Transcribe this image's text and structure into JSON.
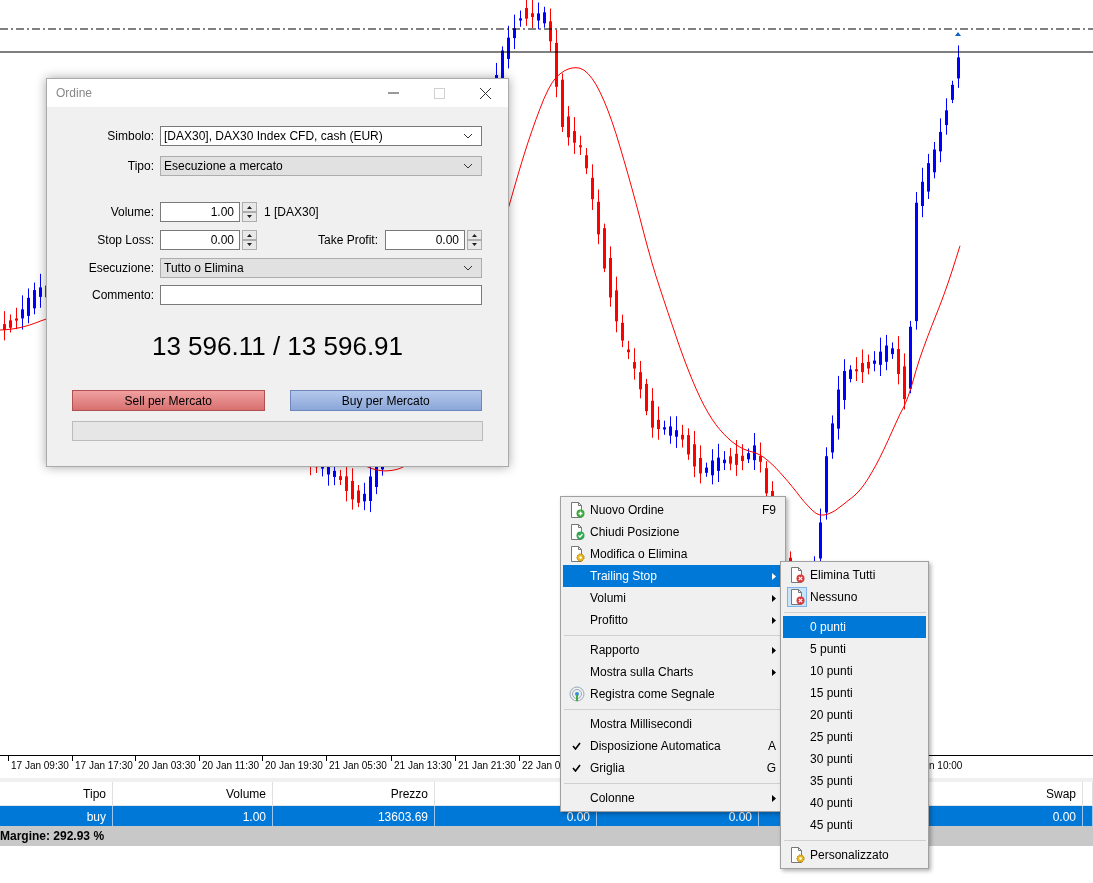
{
  "chart": {
    "time_labels": [
      "17 Jan 09:30",
      "17 Jan 17:30",
      "20 Jan 03:30",
      "20 Jan 11:30",
      "20 Jan 19:30",
      "21 Jan 05:30",
      "21 Jan 13:30",
      "21 Jan 21:30",
      "22 Jan 0",
      "n 10:00"
    ]
  },
  "positions_table": {
    "columns": [
      "Tipo",
      "Volume",
      "Prezzo",
      "",
      "",
      "",
      "Swap"
    ],
    "rows": [
      {
        "cells": [
          "buy",
          "1.00",
          "13603.69",
          "0.00",
          "0.00",
          "",
          "0.00"
        ],
        "selected": true
      }
    ]
  },
  "status_bar": {
    "text": "Margine: 292.93 %"
  },
  "order_dialog": {
    "title": "Ordine",
    "window_buttons": [
      {
        "kind": "minimize",
        "disabled": false
      },
      {
        "kind": "maximize",
        "disabled": true
      },
      {
        "kind": "close",
        "disabled": false
      }
    ],
    "fields": [
      {
        "kind": "combo",
        "label": "Simbolo:",
        "value": "[DAX30], DAX30 Index CFD, cash (EUR)"
      },
      {
        "kind": "dropdown",
        "label": "Tipo:",
        "value": "Esecuzione a mercato"
      },
      {
        "kind": "spin",
        "label": "Volume:",
        "value": "1.00",
        "unit": "1 [DAX30]"
      },
      {
        "kind": "spin-pair",
        "label": "Stop Loss:",
        "value": "0.00",
        "label_2": "Take Profit:",
        "value_2": "0.00"
      },
      {
        "kind": "dropdown",
        "label": "Esecuzione:",
        "value": "Tutto o Elimina"
      },
      {
        "kind": "text",
        "label": "Commento:"
      }
    ],
    "quote": "13 596.11 / 13 596.91",
    "sell_button": "Sell per Mercato",
    "buy_button": "Buy per Mercato"
  },
  "context_menu": {
    "items": [
      {
        "kind": "item",
        "label": "Nuovo Ordine",
        "shortcut": "F9",
        "submenu": false,
        "checked": false,
        "selected": false
      },
      {
        "kind": "item",
        "label": "Chiudi Posizione",
        "submenu": false,
        "checked": false,
        "selected": false
      },
      {
        "kind": "item",
        "label": "Modifica o Elimina",
        "submenu": false,
        "checked": false,
        "selected": false
      },
      {
        "kind": "item",
        "label": "Trailing Stop",
        "submenu": true,
        "checked": false,
        "selected": true
      },
      {
        "kind": "item",
        "label": "Volumi",
        "submenu": true,
        "checked": false,
        "selected": false
      },
      {
        "kind": "item",
        "label": "Profitto",
        "submenu": true,
        "checked": false,
        "selected": false
      },
      {
        "kind": "separator"
      },
      {
        "kind": "item",
        "label": "Rapporto",
        "submenu": true,
        "checked": false,
        "selected": false
      },
      {
        "kind": "item",
        "label": "Mostra sulla Charts",
        "submenu": true,
        "checked": false,
        "selected": false
      },
      {
        "kind": "item",
        "label": "Registra come Segnale",
        "submenu": false,
        "checked": false,
        "selected": false
      },
      {
        "kind": "separator"
      },
      {
        "kind": "item",
        "label": "Mostra Millisecondi",
        "submenu": false,
        "checked": false,
        "selected": false
      },
      {
        "kind": "item",
        "label": "Disposizione Automatica",
        "shortcut": "A",
        "submenu": false,
        "checked": true,
        "selected": false
      },
      {
        "kind": "item",
        "label": "Griglia",
        "shortcut": "G",
        "submenu": false,
        "checked": true,
        "selected": false
      },
      {
        "kind": "separator"
      },
      {
        "kind": "item",
        "label": "Colonne",
        "submenu": true,
        "checked": false,
        "selected": false
      }
    ]
  },
  "trailing_submenu": {
    "items": [
      {
        "kind": "item",
        "label": "Elimina Tutti",
        "checked": false,
        "selected": false
      },
      {
        "kind": "item",
        "label": "Nessuno",
        "checked": true,
        "selected": false
      },
      {
        "kind": "separator"
      },
      {
        "kind": "item",
        "label": "0 punti",
        "checked": false,
        "selected": true
      },
      {
        "kind": "item",
        "label": "5 punti",
        "checked": false,
        "selected": false
      },
      {
        "kind": "item",
        "label": "10 punti",
        "checked": false,
        "selected": false
      },
      {
        "kind": "item",
        "label": "15 punti",
        "checked": false,
        "selected": false
      },
      {
        "kind": "item",
        "label": "20 punti",
        "checked": false,
        "selected": false
      },
      {
        "kind": "item",
        "label": "25 punti",
        "checked": false,
        "selected": false
      },
      {
        "kind": "item",
        "label": "30 punti",
        "checked": false,
        "selected": false
      },
      {
        "kind": "item",
        "label": "35 punti",
        "checked": false,
        "selected": false
      },
      {
        "kind": "item",
        "label": "40 punti",
        "checked": false,
        "selected": false
      },
      {
        "kind": "item",
        "label": "45 punti",
        "checked": false,
        "selected": false
      },
      {
        "kind": "separator"
      },
      {
        "kind": "item",
        "label": "Personalizzato",
        "checked": false,
        "selected": false
      }
    ]
  }
}
